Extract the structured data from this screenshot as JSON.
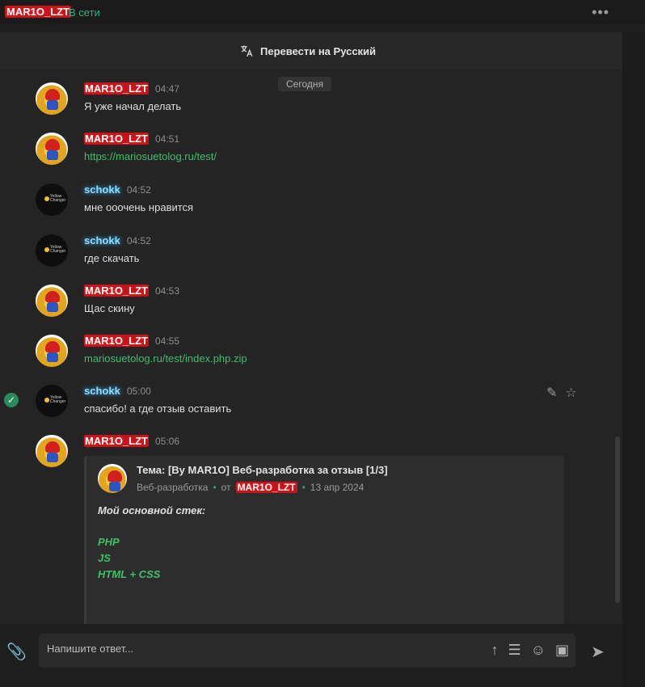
{
  "header": {
    "username": "MAR1O_LZT",
    "status": "В сети",
    "menu_icon": "more-horizontal-icon"
  },
  "translate": {
    "label": "Перевести на Русский",
    "icon": "translate-icon"
  },
  "date_chip": "Сегодня",
  "messages": [
    {
      "user": "MAR1O_LZT",
      "time": "04:47",
      "text": "Я уже начал делать"
    },
    {
      "user": "MAR1O_LZT",
      "time": "04:51",
      "text": "https://mariosuetolog.ru/test/"
    },
    {
      "user": "schokk",
      "time": "04:52",
      "text": "мне ооочень нравится"
    },
    {
      "user": "schokk",
      "time": "04:52",
      "text": "где скачать"
    },
    {
      "user": "MAR1O_LZT",
      "time": "04:53",
      "text": "Щас скину"
    },
    {
      "user": "MAR1O_LZT",
      "time": "04:55",
      "text": "mariosuetolog.ru/test/index.php.zip"
    },
    {
      "user": "schokk",
      "time": "05:00",
      "text": "спасибо! а где отзыв оставить"
    },
    {
      "user": "MAR1O_LZT",
      "time": "05:06",
      "text": ""
    }
  ],
  "schokk_avatar_text": "Yellow Changer",
  "quote": {
    "title": "Тема: [By MAR1O] Веб-разработка за отзыв [1/3]",
    "category": "Веб-разработка",
    "from_label": "от",
    "author": "MAR1O_LZT",
    "date": "13 апр 2024",
    "heading": "Мой основной стек:",
    "lines": [
      "PHP",
      "JS",
      "HTML + CSS"
    ]
  },
  "input": {
    "placeholder": "Напишите ответ..."
  },
  "colors": {
    "accent_green": "#3fbf6a",
    "name_red": "#c4141a",
    "name_blue": "#8fdcff"
  }
}
